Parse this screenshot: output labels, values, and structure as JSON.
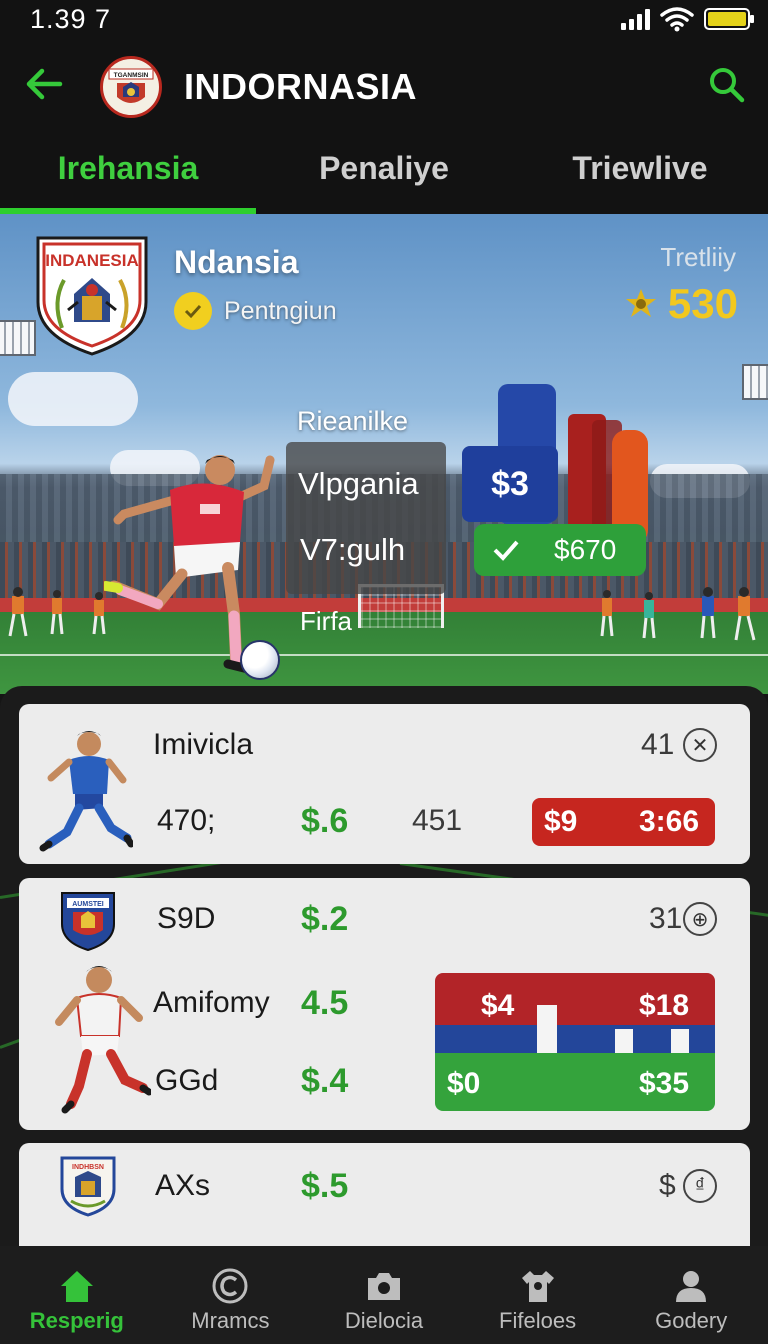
{
  "status_bar": {
    "time": "1.39 7"
  },
  "header": {
    "title": "INDORNASIA",
    "crest_text": "TGANMSIN"
  },
  "tabs": [
    {
      "label": "Irehansia",
      "active": true
    },
    {
      "label": "Penaliye",
      "active": false
    },
    {
      "label": "Triewlive",
      "active": false
    }
  ],
  "hero": {
    "crest_text": "INDANESIA",
    "team_name": "Ndansia",
    "status_text": "Pentngiun",
    "score_label": "Tretliiy",
    "score_value": "530",
    "overlay_label": "Rieanilke",
    "overlay_line1": "Vlpgania",
    "overlay_line2": "V7:gulh",
    "overlay_footer": "Firfa",
    "blue_value": "$3",
    "green_value": "$670"
  },
  "cards": [
    {
      "name": "Imivicla",
      "count": "41",
      "value1": "470;",
      "price": "$.6",
      "value2": "451",
      "pill_left": "$9",
      "pill_right": "3:66"
    },
    {
      "rows": [
        {
          "name": "S9D",
          "price": "$.2"
        },
        {
          "name": "Amifomy",
          "price": "4.5"
        },
        {
          "name": "GGd",
          "price": "$.4"
        }
      ],
      "count": "31",
      "crest_text": "AUMSTEI",
      "combo_top_left": "$4",
      "combo_top_right": "$18",
      "combo_bottom_left": "$0",
      "combo_bottom_right": "$35"
    },
    {
      "name": "AXs",
      "price": "$.5",
      "count": "$",
      "crest_text": "INDHBSN"
    }
  ],
  "bottom_nav": [
    {
      "label": "Resperig",
      "icon": "home-icon",
      "active": true
    },
    {
      "label": "Mramcs",
      "icon": "circle-c-icon",
      "active": false
    },
    {
      "label": "Dielocia",
      "icon": "camera-icon",
      "active": false
    },
    {
      "label": "Fifeloes",
      "icon": "shirt-icon",
      "active": false
    },
    {
      "label": "Godery",
      "icon": "person-icon",
      "active": false
    }
  ],
  "colors": {
    "accent_green": "#2ecf2e",
    "price_green": "#2d9a2d",
    "gold": "#f2c81e",
    "red": "#c6261f",
    "blue": "#1f3f9c"
  }
}
